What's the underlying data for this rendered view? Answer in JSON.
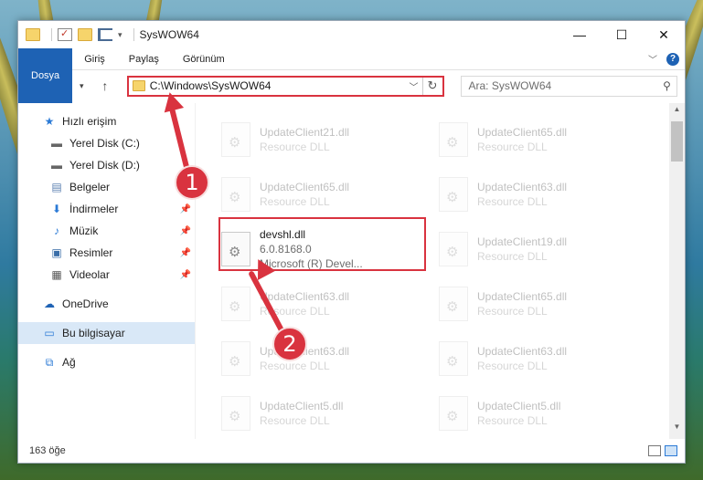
{
  "window": {
    "title": "SysWOW64"
  },
  "ribbon": {
    "tabs": [
      "Dosya",
      "Giriş",
      "Paylaş",
      "Görünüm"
    ]
  },
  "address": {
    "path": "C:\\Windows\\SysWOW64"
  },
  "search": {
    "placeholder": "Ara: SysWOW64"
  },
  "sidebar": {
    "items": [
      {
        "label": "Hızlı erişim",
        "icon": "star-icon"
      },
      {
        "label": "Yerel Disk (C:)",
        "icon": "drive-icon"
      },
      {
        "label": "Yerel Disk (D:)",
        "icon": "drive-icon"
      },
      {
        "label": "Belgeler",
        "icon": "documents-icon"
      },
      {
        "label": "İndirmeler",
        "icon": "download-icon"
      },
      {
        "label": "Müzik",
        "icon": "music-icon"
      },
      {
        "label": "Resimler",
        "icon": "pictures-icon"
      },
      {
        "label": "Videolar",
        "icon": "video-icon"
      },
      {
        "label": "OneDrive",
        "icon": "cloud-icon"
      },
      {
        "label": "Bu bilgisayar",
        "icon": "computer-icon"
      },
      {
        "label": "Ağ",
        "icon": "network-icon"
      }
    ]
  },
  "files": [
    {
      "name": "UpdateClient21.dll",
      "desc": "Resource DLL",
      "faded": true
    },
    {
      "name": "UpdateClient65.dll",
      "desc": "Resource DLL",
      "faded": true
    },
    {
      "name": "UpdateClient65.dll",
      "desc": "Resource DLL",
      "faded": true
    },
    {
      "name": "UpdateClient63.dll",
      "desc": "Resource DLL",
      "faded": true
    },
    {
      "name": "devshl.dll",
      "desc": "6.0.8168.0",
      "desc2": "Microsoft (R) Devel...",
      "faded": false
    },
    {
      "name": "UpdateClient19.dll",
      "desc": "Resource DLL",
      "faded": true
    },
    {
      "name": "UpdateClient63.dll",
      "desc": "Resource DLL",
      "faded": true
    },
    {
      "name": "UpdateClient65.dll",
      "desc": "Resource DLL",
      "faded": true
    },
    {
      "name": "UpdateClient63.dll",
      "desc": "Resource DLL",
      "faded": true
    },
    {
      "name": "UpdateClient63.dll",
      "desc": "Resource DLL",
      "faded": true
    },
    {
      "name": "UpdateClient5.dll",
      "desc": "Resource DLL",
      "faded": true
    },
    {
      "name": "UpdateClient5.dll",
      "desc": "Resource DLL",
      "faded": true
    }
  ],
  "status": {
    "count": "163 öğe"
  },
  "annotations": {
    "step1": "1",
    "step2": "2",
    "color": "#d9333f"
  }
}
